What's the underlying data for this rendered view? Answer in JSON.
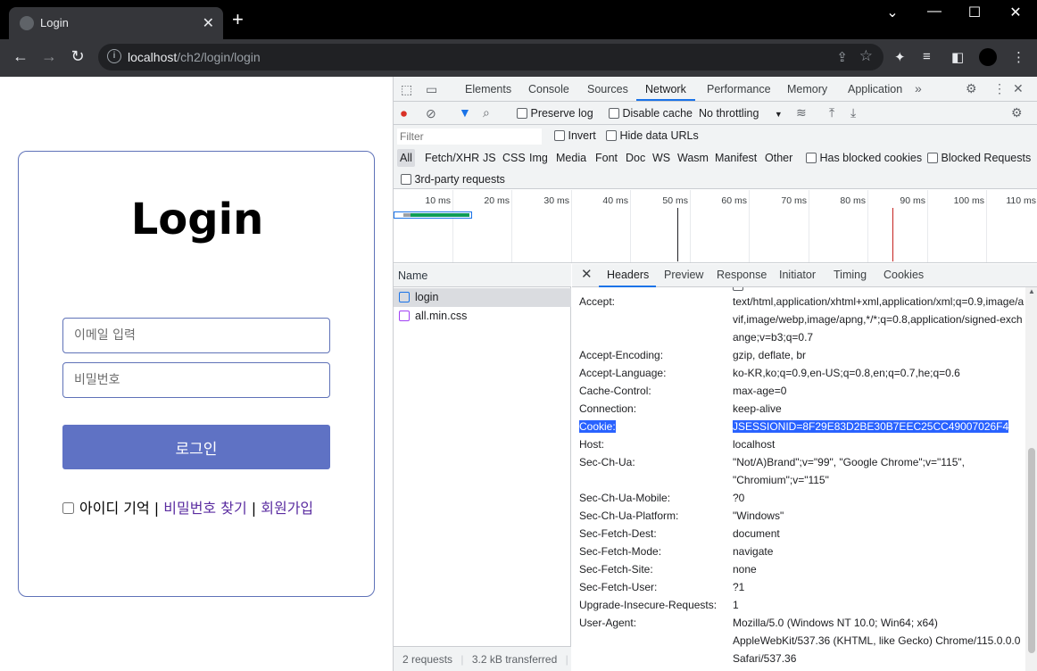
{
  "browser": {
    "tab_title": "Login",
    "url_host": "localhost",
    "url_path": "/ch2/login/login"
  },
  "page": {
    "title": "Login",
    "email_placeholder": "이메일 입력",
    "password_placeholder": "비밀번호",
    "login_button": "로그인",
    "remember_label": "아이디 기억",
    "separator": "|",
    "find_password": "비밀번호 찾기",
    "signup": "회원가입"
  },
  "devtools": {
    "tabs": [
      "Elements",
      "Console",
      "Sources",
      "Network",
      "Performance",
      "Memory",
      "Application"
    ],
    "active_tab": "Network",
    "toolbar": {
      "preserve_log": "Preserve log",
      "disable_cache": "Disable cache",
      "throttling": "No throttling"
    },
    "filter": {
      "placeholder": "Filter",
      "invert": "Invert",
      "hide_data_urls": "Hide data URLs",
      "types": [
        "All",
        "Fetch/XHR",
        "JS",
        "CSS",
        "Img",
        "Media",
        "Font",
        "Doc",
        "WS",
        "Wasm",
        "Manifest",
        "Other"
      ],
      "has_blocked_cookies": "Has blocked cookies",
      "blocked_requests": "Blocked Requests",
      "third_party": "3rd-party requests"
    },
    "timeline_ticks": [
      "10 ms",
      "20 ms",
      "30 ms",
      "40 ms",
      "50 ms",
      "60 ms",
      "70 ms",
      "80 ms",
      "90 ms",
      "100 ms",
      "110 ms"
    ],
    "name_header": "Name",
    "requests": [
      {
        "name": "login",
        "type": "doc"
      },
      {
        "name": "all.min.css",
        "type": "css"
      }
    ],
    "status": {
      "requests": "2 requests",
      "transferred": "3.2 kB transferred"
    },
    "detail_tabs": [
      "Headers",
      "Preview",
      "Response",
      "Initiator",
      "Timing",
      "Cookies"
    ],
    "active_detail_tab": "Headers",
    "request_headers": [
      {
        "name": "Accept:",
        "value": "text/html,application/xhtml+xml,application/xml;q=0.9,image/avif,image/webp,image/apng,*/*;q=0.8,application/signed-exchange;v=b3;q=0.7"
      },
      {
        "name": "Accept-Encoding:",
        "value": "gzip, deflate, br"
      },
      {
        "name": "Accept-Language:",
        "value": "ko-KR,ko;q=0.9,en-US;q=0.8,en;q=0.7,he;q=0.6"
      },
      {
        "name": "Cache-Control:",
        "value": "max-age=0"
      },
      {
        "name": "Connection:",
        "value": "keep-alive"
      },
      {
        "name": "Cookie:",
        "value": "JSESSIONID=8F29E83D2BE30B7EEC25CC49007026F4",
        "highlight": true
      },
      {
        "name": "Host:",
        "value": "localhost"
      },
      {
        "name": "Sec-Ch-Ua:",
        "value": "\"Not/A)Brand\";v=\"99\", \"Google Chrome\";v=\"115\", \"Chromium\";v=\"115\""
      },
      {
        "name": "Sec-Ch-Ua-Mobile:",
        "value": "?0"
      },
      {
        "name": "Sec-Ch-Ua-Platform:",
        "value": "\"Windows\""
      },
      {
        "name": "Sec-Fetch-Dest:",
        "value": "document"
      },
      {
        "name": "Sec-Fetch-Mode:",
        "value": "navigate"
      },
      {
        "name": "Sec-Fetch-Site:",
        "value": "none"
      },
      {
        "name": "Sec-Fetch-User:",
        "value": "?1"
      },
      {
        "name": "Upgrade-Insecure-Requests:",
        "value": "1"
      },
      {
        "name": "User-Agent:",
        "value": "Mozilla/5.0 (Windows NT 10.0; Win64; x64) AppleWebKit/537.36 (KHTML, like Gecko) Chrome/115.0.0.0 Safari/537.36"
      }
    ]
  },
  "colors": {
    "accent_blue": "#1a73e8",
    "login_button": "#5f72c4",
    "cookie_highlight": "#2962ff"
  }
}
